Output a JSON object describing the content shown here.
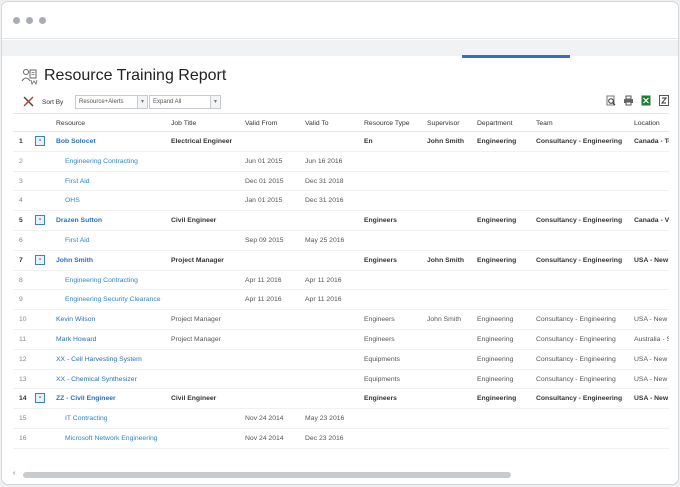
{
  "report": {
    "title": "Resource Training Report"
  },
  "toolbar": {
    "sort_label": "Sort By",
    "sort_value": "Resource+Alerts",
    "expand_value": "Expand All",
    "icons": [
      "scissors-icon",
      "print-preview-icon",
      "printer-icon",
      "excel-export-icon",
      "pdf-export-icon"
    ]
  },
  "columns": {
    "resource": "Resource",
    "job_title": "Job Title",
    "valid_from": "Valid From",
    "valid_to": "Valid To",
    "resource_type": "Resource Type",
    "supervisor": "Supervisor",
    "department": "Department",
    "team": "Team",
    "location": "Location"
  },
  "rows": [
    {
      "num": "1",
      "group": true,
      "resource": "Bob Solocet",
      "job": "Electrical Engineer",
      "from": "",
      "to": "",
      "rtype": "En",
      "sup": "John Smith",
      "dept": "Engineering",
      "team": "Consultancy - Engineering",
      "loc": "Canada - To"
    },
    {
      "num": "2",
      "child": true,
      "resource": "Engineering Contracting",
      "job": "",
      "from": "Jun 01 2015",
      "to": "Jun 16 2016",
      "rtype": "",
      "sup": "",
      "dept": "",
      "team": "",
      "loc": ""
    },
    {
      "num": "3",
      "child": true,
      "resource": "First Aid",
      "job": "",
      "from": "Dec 01 2015",
      "to": "Dec 31 2018",
      "rtype": "",
      "sup": "",
      "dept": "",
      "team": "",
      "loc": ""
    },
    {
      "num": "4",
      "child": true,
      "resource": "OHS",
      "job": "",
      "from": "Jan 01 2015",
      "to": "Dec 31 2016",
      "rtype": "",
      "sup": "",
      "dept": "",
      "team": "",
      "loc": ""
    },
    {
      "num": "5",
      "group": true,
      "resource": "Drazen Sutton",
      "job": "Civil Engineer",
      "from": "",
      "to": "",
      "rtype": "Engineers",
      "sup": "",
      "dept": "Engineering",
      "team": "Consultancy - Engineering",
      "loc": "Canada - Va"
    },
    {
      "num": "6",
      "child": true,
      "resource": "First Aid",
      "job": "",
      "from": "Sep 09 2015",
      "to": "May 25 2016",
      "rtype": "",
      "sup": "",
      "dept": "",
      "team": "",
      "loc": ""
    },
    {
      "num": "7",
      "group": true,
      "resource": "John Smith",
      "job": "Project Manager",
      "from": "",
      "to": "",
      "rtype": "Engineers",
      "sup": "John Smith",
      "dept": "Engineering",
      "team": "Consultancy - Engineering",
      "loc": "USA - New"
    },
    {
      "num": "8",
      "child": true,
      "resource": "Engineering Contracting",
      "job": "",
      "from": "Apr 11 2016",
      "to": "Apr 11 2016",
      "rtype": "",
      "sup": "",
      "dept": "",
      "team": "",
      "loc": ""
    },
    {
      "num": "9",
      "child": true,
      "resource": "Engineering Security Clearance",
      "job": "",
      "from": "Apr 11 2016",
      "to": "Apr 11 2016",
      "rtype": "",
      "sup": "",
      "dept": "",
      "team": "",
      "loc": ""
    },
    {
      "num": "10",
      "resource": "Kevin Wilson",
      "job": "Project Manager",
      "from": "",
      "to": "",
      "rtype": "Engineers",
      "sup": "John Smith",
      "dept": "Engineering",
      "team": "Consultancy - Engineering",
      "loc": "USA - New Y"
    },
    {
      "num": "11",
      "resource": "Mark Howard",
      "job": "Project Manager",
      "from": "",
      "to": "",
      "rtype": "Engineers",
      "sup": "",
      "dept": "Engineering",
      "team": "Consultancy - Engineering",
      "loc": "Australia - S"
    },
    {
      "num": "12",
      "resource": "XX - Cell Harvesting System",
      "job": "",
      "from": "",
      "to": "",
      "rtype": "Equipments",
      "sup": "",
      "dept": "Engineering",
      "team": "Consultancy - Engineering",
      "loc": "USA - New Y"
    },
    {
      "num": "13",
      "resource": "XX - Chemical Synthesizer",
      "job": "",
      "from": "",
      "to": "",
      "rtype": "Equipments",
      "sup": "",
      "dept": "Engineering",
      "team": "Consultancy - Engineering",
      "loc": "USA - New Y"
    },
    {
      "num": "14",
      "group": true,
      "resource": "ZZ - Civil Engineer",
      "job": "Civil Engineer",
      "from": "",
      "to": "",
      "rtype": "Engineers",
      "sup": "",
      "dept": "Engineering",
      "team": "Consultancy - Engineering",
      "loc": "USA - New"
    },
    {
      "num": "15",
      "child": true,
      "resource": "IT Contracting",
      "job": "",
      "from": "Nov 24 2014",
      "to": "May 23 2016",
      "rtype": "",
      "sup": "",
      "dept": "",
      "team": "",
      "loc": ""
    },
    {
      "num": "16",
      "child": true,
      "resource": "Microsoft Network Engineering",
      "job": "",
      "from": "Nov 24 2014",
      "to": "Dec 23 2016",
      "rtype": "",
      "sup": "",
      "dept": "",
      "team": "",
      "loc": ""
    }
  ],
  "scroll": {
    "left_arrow": "‹"
  }
}
